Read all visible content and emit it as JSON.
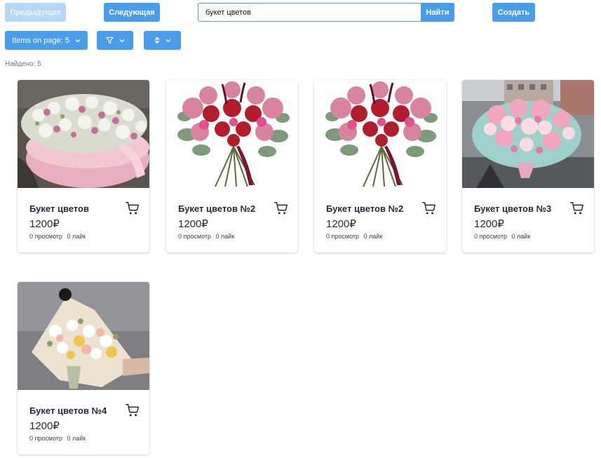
{
  "toolbar": {
    "prev_label": "Предыдущая",
    "next_label": "Следующая",
    "search_value": "букет цветов",
    "search_button": "Найти",
    "create_label": "Создать"
  },
  "filters": {
    "items_per_page_label": "Items on page: 5",
    "filter_icon": "funnel-icon",
    "sort_icon": "sort-icon"
  },
  "found_text": "Найдено: 5",
  "colors": {
    "accent": "#4a9de8",
    "accent_disabled": "#b6d7f5"
  },
  "products": [
    {
      "title": "Букет цветов",
      "price": "1200₽",
      "views": "0 просмотр",
      "likes": "0 лайк",
      "image": "pink-orchid-hatbox"
    },
    {
      "title": "Букет цветов №2",
      "price": "1200₽",
      "views": "0 просмотр",
      "likes": "0 лайк",
      "image": "red-pink-orchid-bouquet"
    },
    {
      "title": "Букет цветов №2",
      "price": "1200₽",
      "views": "0 просмотр",
      "likes": "0 лайк",
      "image": "red-pink-orchid-bouquet"
    },
    {
      "title": "Букет цветов №3",
      "price": "1200₽",
      "views": "0 просмотр",
      "likes": "0 лайк",
      "image": "pastel-roses-street"
    },
    {
      "title": "Букет цветов №4",
      "price": "1200₽",
      "views": "0 просмотр",
      "likes": "0 лайк",
      "image": "white-yellow-wrapped"
    }
  ]
}
